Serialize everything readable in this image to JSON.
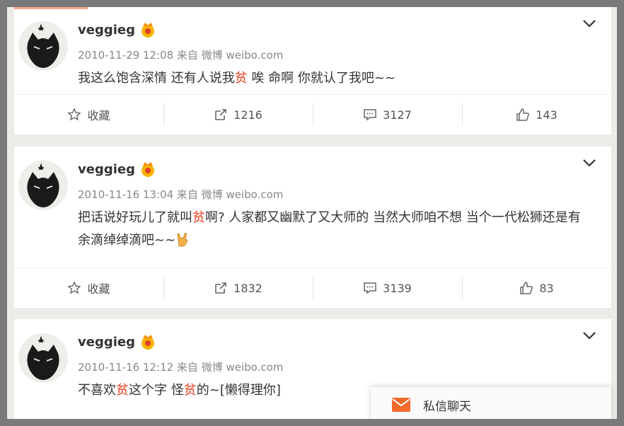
{
  "posts": [
    {
      "username": "veggieg",
      "meta": "2010-11-29 12:08 来自 微博 weibo.com",
      "text_segments": [
        "我这么饱含深情 还有人说我",
        "贫",
        " 唉 命啊 你就认了我吧~~"
      ],
      "actions": {
        "favorite": "收藏",
        "repost": "1216",
        "comment": "3127",
        "like": "143"
      }
    },
    {
      "username": "veggieg",
      "meta": "2010-11-16 13:04 来自 微博 weibo.com",
      "text_segments": [
        "把话说好玩儿了就叫",
        "贫",
        "啊? 人家都又幽默了又大师的 当然大师咱不想 当个一代松狮还是有余滴绰绰滴吧~~"
      ],
      "actions": {
        "favorite": "收藏",
        "repost": "1832",
        "comment": "3139",
        "like": "83"
      }
    },
    {
      "username": "veggieg",
      "meta": "2010-11-16 12:12 来自 微博 weibo.com",
      "text_segments": [
        "不喜欢",
        "贫",
        "这个字 怪",
        "贫",
        "的~[懒得理你]"
      ]
    }
  ],
  "dm_popup": {
    "label": "私信聊天"
  },
  "icons": {
    "avatar": "black-cat-avatar",
    "vip": "vip-crown-icon",
    "more": "chevron-down-icon",
    "favorite": "star-icon",
    "repost": "repost-icon",
    "comment": "comment-icon",
    "like": "thumbs-up-icon",
    "dm": "mail-icon",
    "emoji": "rock-hand-emoji"
  },
  "colors": {
    "highlight": "#eb3b1e",
    "vip": "#f5b400",
    "mail": "#f26b2b"
  }
}
